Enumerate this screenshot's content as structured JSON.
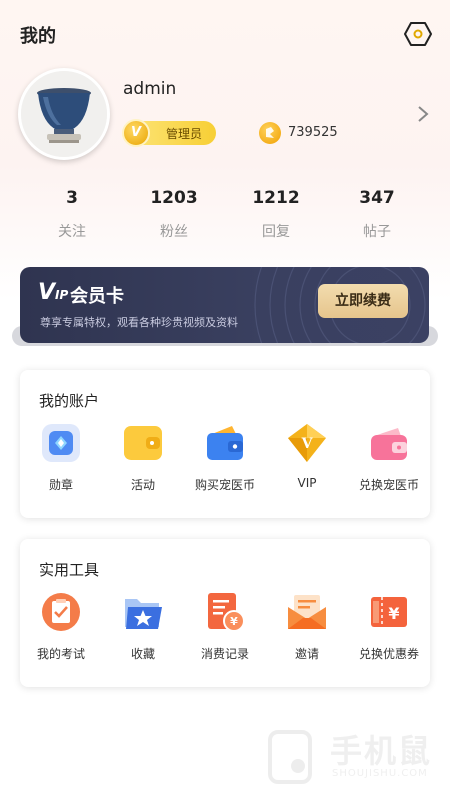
{
  "header": {
    "title": "我的"
  },
  "profile": {
    "username": "admin",
    "role": "管理员",
    "role_badge_letter": "V",
    "coins": "739525"
  },
  "stats": [
    {
      "value": "3",
      "label": "关注"
    },
    {
      "value": "1203",
      "label": "粉丝"
    },
    {
      "value": "1212",
      "label": "回复"
    },
    {
      "value": "347",
      "label": "帖子"
    }
  ],
  "vip": {
    "logo_v": "V",
    "logo_ip": "IP",
    "title": "会员卡",
    "description": "尊享专属特权，观看各种珍贵视频及资料",
    "button": "立即续费"
  },
  "account_section": {
    "title": "我的账户",
    "items": [
      {
        "label": "勋章",
        "icon": "medal-icon"
      },
      {
        "label": "活动",
        "icon": "activity-wallet-icon"
      },
      {
        "label": "购买宠医币",
        "icon": "wallet-icon"
      },
      {
        "label": "VIP",
        "icon": "vip-diamond-icon"
      },
      {
        "label": "兑换宠医币",
        "icon": "exchange-wallet-icon"
      }
    ]
  },
  "tools_section": {
    "title": "实用工具",
    "items": [
      {
        "label": "我的考试",
        "icon": "exam-icon"
      },
      {
        "label": "收藏",
        "icon": "favorites-folder-icon"
      },
      {
        "label": "消费记录",
        "icon": "consumption-record-icon"
      },
      {
        "label": "邀请",
        "icon": "invite-envelope-icon"
      },
      {
        "label": "兑换优惠券",
        "icon": "coupon-icon"
      }
    ]
  },
  "watermark": {
    "text": "手机鼠",
    "sub": "SHOUJISHU.COM"
  },
  "colors": {
    "accent_gold": "#f7cf35",
    "vip_card": "#353a58",
    "vip_button": "#e9cb95",
    "muted_text": "#999999"
  }
}
